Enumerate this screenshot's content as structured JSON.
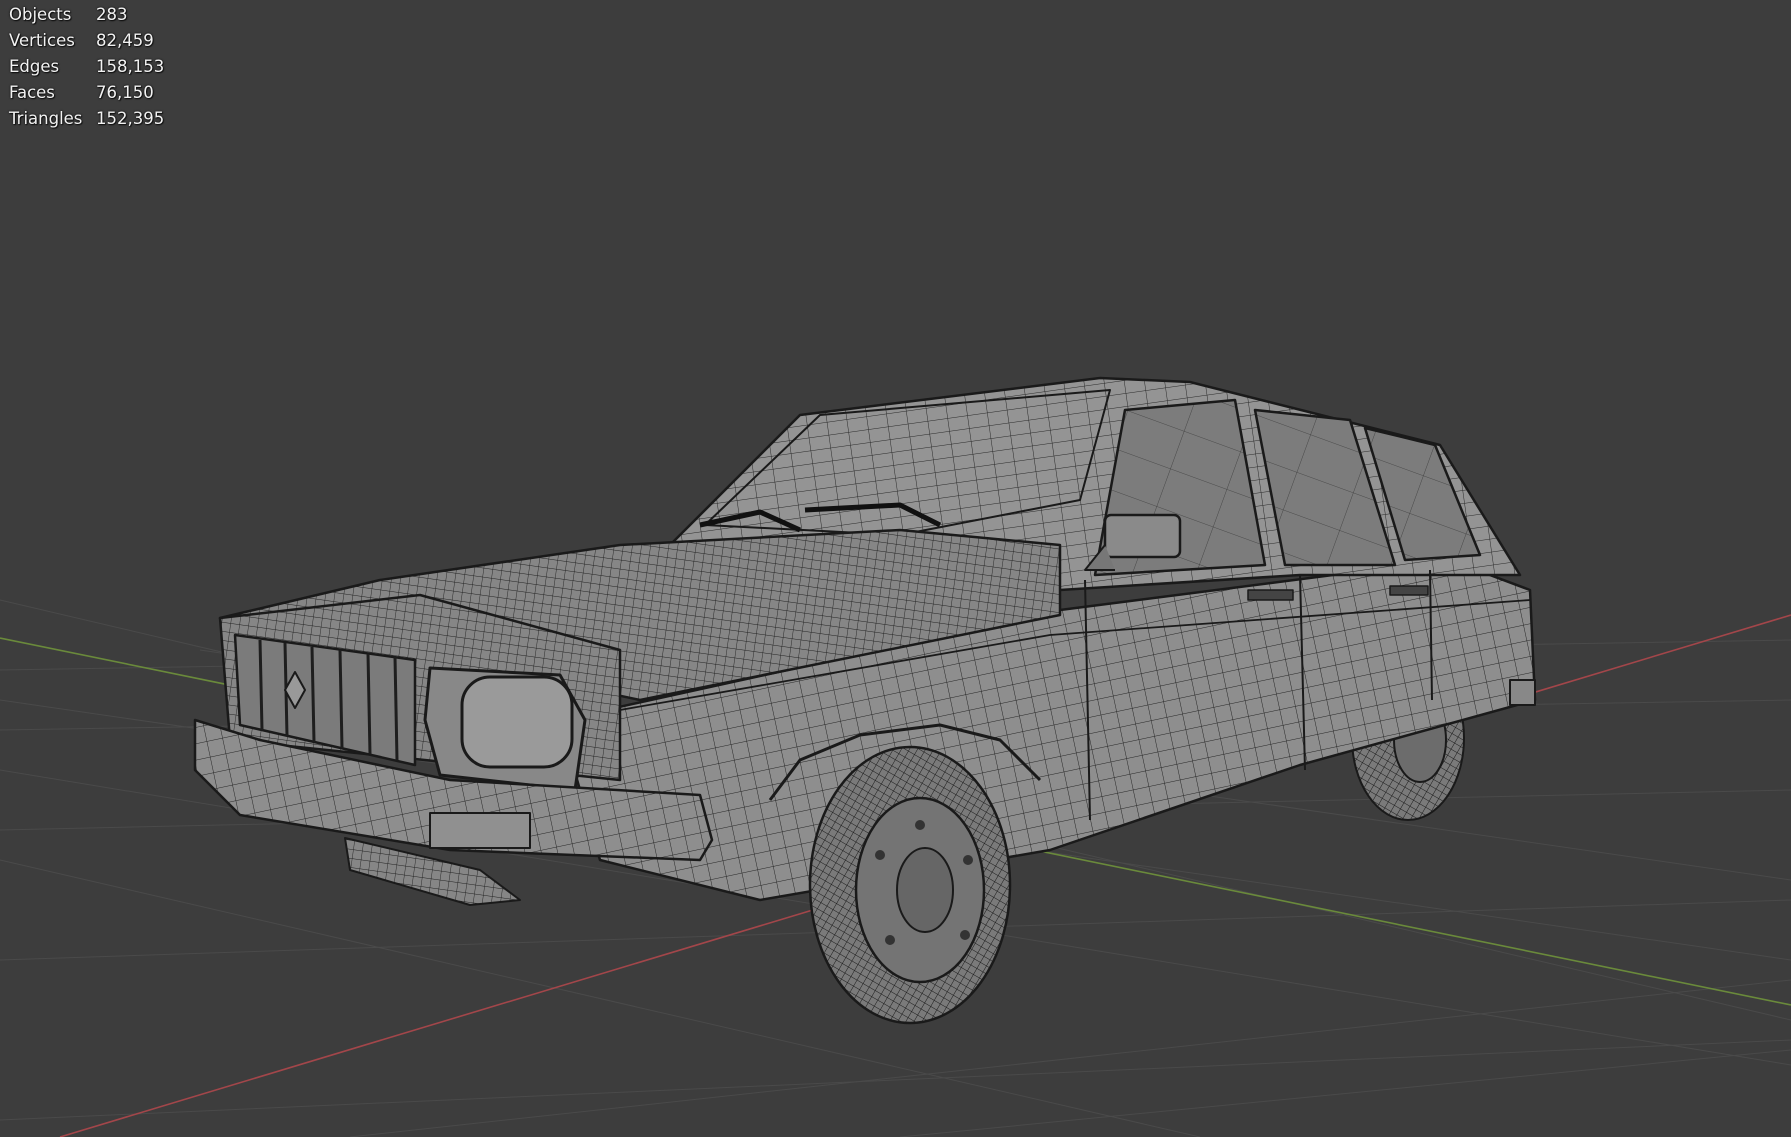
{
  "viewport": {
    "background": "#3d3d3d",
    "x_axis_color": "#a3464a",
    "y_axis_color": "#6a8a3b",
    "grid_color": "#4a4a4a"
  },
  "statistics": {
    "rows": [
      {
        "label": "Objects",
        "value": "283"
      },
      {
        "label": "Vertices",
        "value": "82,459"
      },
      {
        "label": "Edges",
        "value": "158,153"
      },
      {
        "label": "Faces",
        "value": "76,150"
      },
      {
        "label": "Triangles",
        "value": "152,395"
      }
    ]
  },
  "scene": {
    "object": "station-wagon-car",
    "shading": "solid-wireframe",
    "body_color": "#8e8e8e",
    "wire_color": "#1c1c1c"
  }
}
